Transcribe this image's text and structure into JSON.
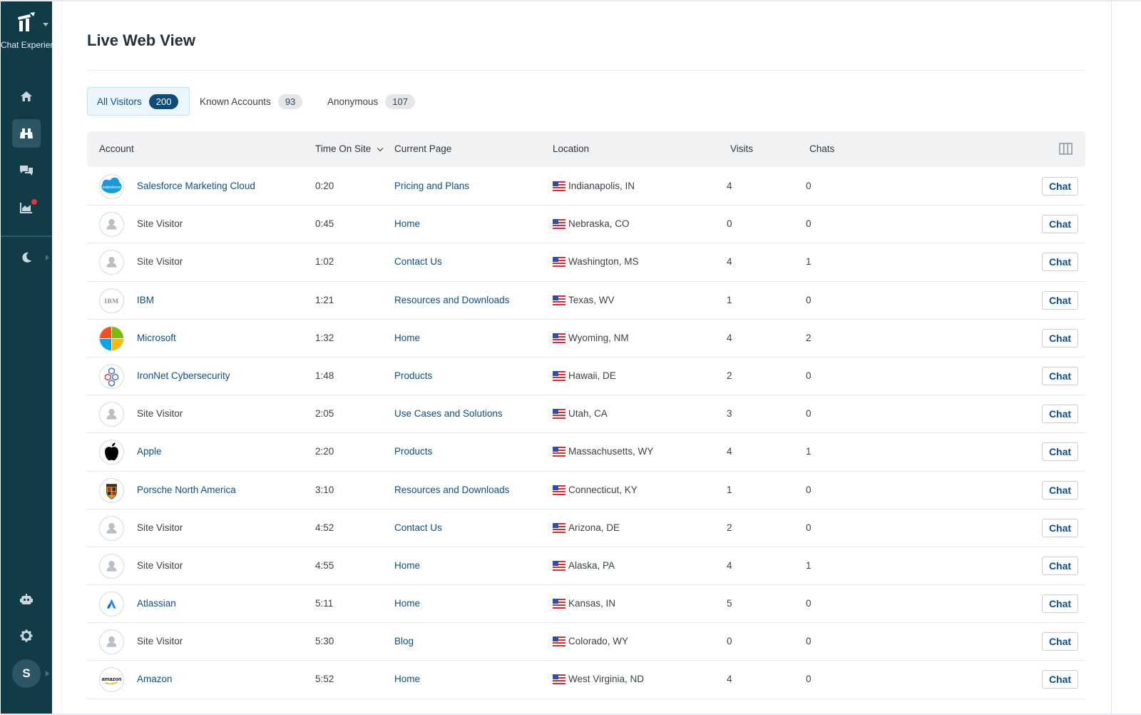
{
  "sidebar": {
    "app_name": "Chat Experien...",
    "nav": [
      {
        "icon": "home-icon"
      },
      {
        "icon": "binoculars-icon"
      },
      {
        "icon": "chat-bubbles-icon"
      },
      {
        "icon": "analytics-chart-icon"
      },
      {
        "icon": "moon-icon"
      },
      {
        "icon": "robot-icon"
      },
      {
        "icon": "gear-icon"
      }
    ],
    "user_initial": "S"
  },
  "page": {
    "title": "Live Web View"
  },
  "tabs": [
    {
      "label": "All Visitors",
      "count": "200",
      "active": true
    },
    {
      "label": "Known Accounts",
      "count": "93",
      "active": false
    },
    {
      "label": "Anonymous",
      "count": "107",
      "active": false
    }
  ],
  "table": {
    "columns": {
      "account": "Account",
      "time": "Time On Site",
      "page": "Current Page",
      "location": "Location",
      "visits": "Visits",
      "chats": "Chats"
    },
    "chat_label": "Chat",
    "rows": [
      {
        "logo": "salesforce",
        "logo_text": "salesforce",
        "account": "Salesforce Marketing Cloud",
        "known": true,
        "time": "0:20",
        "page": "Pricing and Plans",
        "location": "Indianapolis, IN",
        "visits": "4",
        "chats": "0"
      },
      {
        "logo": "visitor",
        "logo_text": "",
        "account": "Site Visitor",
        "known": false,
        "time": "0:45",
        "page": "Home",
        "location": "Nebraska, CO",
        "visits": "0",
        "chats": "0"
      },
      {
        "logo": "visitor",
        "logo_text": "",
        "account": "Site Visitor",
        "known": false,
        "time": "1:02",
        "page": "Contact Us",
        "location": "Washington, MS",
        "visits": "4",
        "chats": "1"
      },
      {
        "logo": "ibm",
        "logo_text": "IBM",
        "account": "IBM",
        "known": true,
        "time": "1:21",
        "page": "Resources and Downloads",
        "location": "Texas, WV",
        "visits": "1",
        "chats": "0"
      },
      {
        "logo": "microsoft",
        "logo_text": "",
        "account": "Microsoft",
        "known": true,
        "time": "1:32",
        "page": "Home",
        "location": "Wyoming, NM",
        "visits": "4",
        "chats": "2"
      },
      {
        "logo": "ironnet",
        "logo_text": "",
        "account": "IronNet Cybersecurity",
        "known": true,
        "time": "1:48",
        "page": "Products",
        "location": "Hawaii, DE",
        "visits": "2",
        "chats": "0"
      },
      {
        "logo": "visitor",
        "logo_text": "",
        "account": "Site Visitor",
        "known": false,
        "time": "2:05",
        "page": "Use Cases and Solutions",
        "location": "Utah, CA",
        "visits": "3",
        "chats": "0"
      },
      {
        "logo": "apple",
        "logo_text": "",
        "account": "Apple",
        "known": true,
        "time": "2:20",
        "page": "Products",
        "location": "Massachusetts, WY",
        "visits": "4",
        "chats": "1"
      },
      {
        "logo": "porsche",
        "logo_text": "",
        "account": "Porsche North America",
        "known": true,
        "time": "3:10",
        "page": "Resources and Downloads",
        "location": "Connecticut, KY",
        "visits": "1",
        "chats": "0"
      },
      {
        "logo": "visitor",
        "logo_text": "",
        "account": "Site Visitor",
        "known": false,
        "time": "4:52",
        "page": "Contact Us",
        "location": "Arizona, DE",
        "visits": "2",
        "chats": "0"
      },
      {
        "logo": "visitor",
        "logo_text": "",
        "account": "Site Visitor",
        "known": false,
        "time": "4:55",
        "page": "Home",
        "location": "Alaska, PA",
        "visits": "4",
        "chats": "1"
      },
      {
        "logo": "atlassian",
        "logo_text": "",
        "account": "Atlassian",
        "known": true,
        "time": "5:11",
        "page": "Home",
        "location": "Kansas, IN",
        "visits": "5",
        "chats": "0"
      },
      {
        "logo": "visitor",
        "logo_text": "",
        "account": "Site Visitor",
        "known": false,
        "time": "5:30",
        "page": "Blog",
        "location": "Colorado, WY",
        "visits": "0",
        "chats": "0"
      },
      {
        "logo": "amazon",
        "logo_text": "amazon",
        "account": "Amazon",
        "known": true,
        "time": "5:52",
        "page": "Home",
        "location": "West Virginia, ND",
        "visits": "4",
        "chats": "0"
      }
    ]
  },
  "colors": {
    "sidebar_bg": "#123b48",
    "link": "#0e4f86",
    "active_badge": "#0e4b78",
    "notification": "#e8323c"
  }
}
